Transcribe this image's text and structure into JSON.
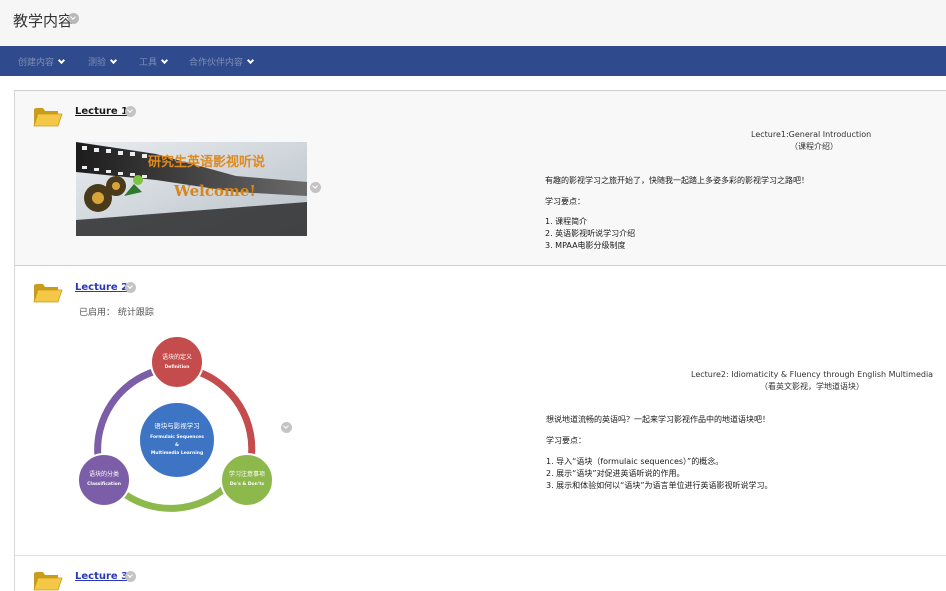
{
  "page": {
    "title": "教学内容"
  },
  "action_bar": {
    "items": [
      {
        "label": "创建内容"
      },
      {
        "label": "测验"
      },
      {
        "label": "工具"
      },
      {
        "label": "合作伙伴内容"
      }
    ]
  },
  "lectures": [
    {
      "title": "Lecture 1",
      "banner": {
        "chinese_title": "研究生英语影视听说",
        "welcome_text": "Welcome!"
      },
      "heading_line1": "Lecture1:General Introduction",
      "heading_line2": "（课程介绍）",
      "intro": "有趣的影视学习之旅开始了，快随我一起踏上多姿多彩的影视学习之路吧！",
      "points_label": "学习要点：",
      "points": [
        "1. 课程简介",
        "2. 英语影视听说学习介绍",
        "3. MPAA电影分级制度"
      ]
    },
    {
      "title": "Lecture 2",
      "status": "已启用：  统计跟踪",
      "diagram": {
        "center": {
          "cn": "语块与影视学习",
          "en1": "Formulaic Sequences",
          "amp": "&",
          "en2": "Multimedia Learning"
        },
        "top": {
          "cn": "语块的定义",
          "en": "Definition"
        },
        "left": {
          "cn": "语块的分类",
          "en": "Classification"
        },
        "right": {
          "cn": "学习注意事项",
          "en": "Do's & Don'ts"
        }
      },
      "heading_line1": "Lecture2: Idiomaticity & Fluency through English Multimedia",
      "heading_line2": "（看英文影视，学地道语块）",
      "intro": "想说地道流畅的英语吗？一起来学习影视作品中的地道语块吧！",
      "points_label": "学习要点：",
      "points": [
        "1. 导入“语块（formulaic sequences）”的概念。",
        "2. 展示“语块”对促进英语听说的作用。",
        "3. 展示和体验如何以“语块”为语言单位进行英语影视听说学习。"
      ]
    },
    {
      "title": "Lecture 3"
    }
  ],
  "colors": {
    "action_bar": "#2f4b8d",
    "link": "#2a37b8",
    "red": "#c44c4c",
    "blue": "#3e74c4",
    "green": "#8db84c",
    "purple": "#7b5ea7"
  }
}
